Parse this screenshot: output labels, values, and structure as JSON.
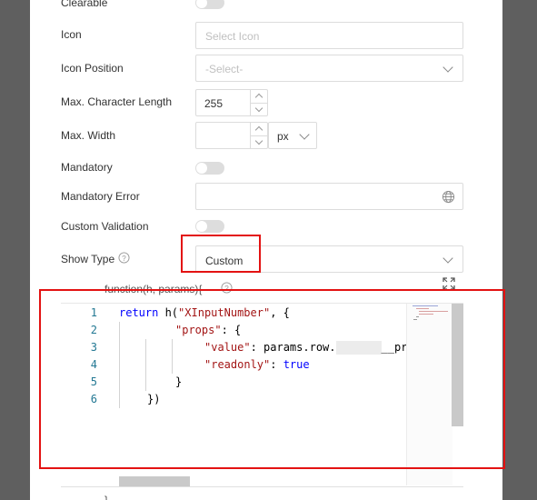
{
  "form": {
    "clearable_label": "Clearable",
    "icon_label": "Icon",
    "icon_placeholder": "Select Icon",
    "icon_position_label": "Icon Position",
    "icon_position_placeholder": "-Select-",
    "max_length_label": "Max. Character Length",
    "max_length_value": "255",
    "max_width_label": "Max. Width",
    "max_width_value": "",
    "max_width_unit": "px",
    "mandatory_label": "Mandatory",
    "mandatory_error_label": "Mandatory Error",
    "custom_validation_label": "Custom Validation",
    "show_type_label": "Show Type",
    "show_type_value": "Custom"
  },
  "editor": {
    "header": "function(h, params){",
    "footer": "}",
    "line_numbers": [
      "1",
      "2",
      "3",
      "4",
      "5",
      "6"
    ],
    "code": {
      "l1_kw": "return",
      "l1_fn": " h(",
      "l1_str": "\"XInputNumber\"",
      "l1_tail": ", {",
      "l2_key": "\"props\"",
      "l2_tail": ": {",
      "l3_key": "\"value\"",
      "l3_tail": ": params.row.",
      "l3_end": "__prod",
      "l4_key": "\"readonly\"",
      "l4_colon": ": ",
      "l4_val": "true",
      "l5": "}",
      "l6": "})"
    }
  },
  "colors": {
    "highlight": "#e31212",
    "code_keyword": "#0000ff",
    "code_string": "#a31515",
    "line_number": "#237893"
  }
}
